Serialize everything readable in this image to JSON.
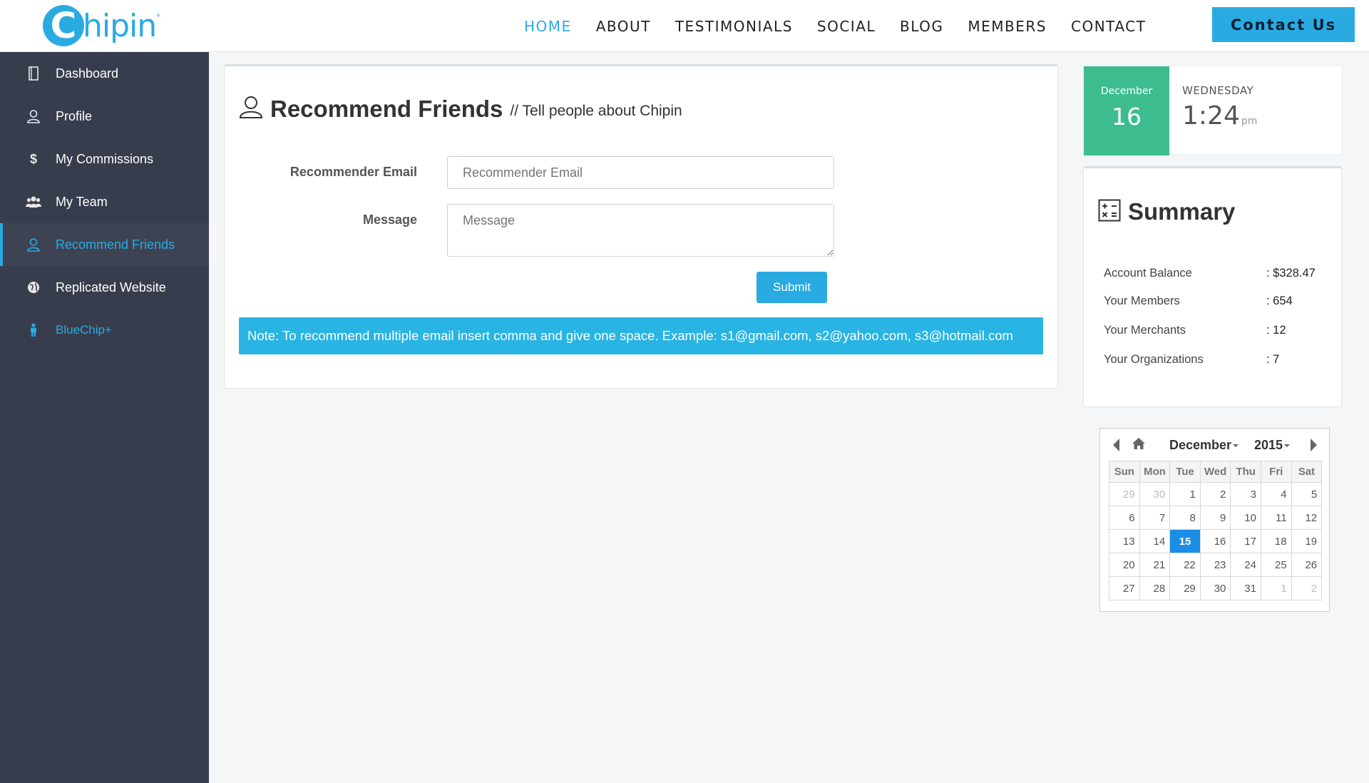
{
  "brand": {
    "logo_letter": "C",
    "logo_rest": "hipin",
    "logo_mark": "°"
  },
  "nav": {
    "items": [
      "HOME",
      "ABOUT",
      "TESTIMONIALS",
      "SOCIAL",
      "BLOG",
      "MEMBERS",
      "CONTACT"
    ],
    "active": "HOME",
    "cta": "Contact Us"
  },
  "sidebar": {
    "items": [
      {
        "label": "Dashboard",
        "icon": "notebook-icon"
      },
      {
        "label": "Profile",
        "icon": "user-icon"
      },
      {
        "label": "My Commissions",
        "icon": "dollar-icon"
      },
      {
        "label": "My Team",
        "icon": "group-icon"
      },
      {
        "label": "Recommend Friends",
        "icon": "user-icon"
      },
      {
        "label": "Replicated Website",
        "icon": "globe-icon"
      },
      {
        "label": "BlueChip+",
        "icon": "person-icon"
      }
    ],
    "active": "Recommend Friends"
  },
  "main": {
    "title": "Recommend Friends",
    "subtitle": "// Tell people about Chipin",
    "email_label": "Recommender Email",
    "email_placeholder": "Recommender Email",
    "message_label": "Message",
    "message_placeholder": "Message",
    "submit_label": "Submit",
    "note": "Note: To recommend multiple email insert comma and give one space. Example: s1@gmail.com, s2@yahoo.com, s3@hotmail.com"
  },
  "datetime": {
    "month": "December",
    "day": "16",
    "weekday": "WEDNESDAY",
    "time": "1:24",
    "ampm": "pm"
  },
  "summary": {
    "title": "Summary",
    "rows": [
      {
        "label": "Account Balance",
        "value": ": $328.47"
      },
      {
        "label": "Your Members",
        "value": ": 654"
      },
      {
        "label": "Your Merchants",
        "value": ": 12"
      },
      {
        "label": "Your Organizations",
        "value": ": 7"
      }
    ]
  },
  "calendar": {
    "month": "December",
    "year": "2015",
    "weekdays": [
      "Sun",
      "Mon",
      "Tue",
      "Wed",
      "Thu",
      "Fri",
      "Sat"
    ],
    "weeks": [
      [
        "29",
        "30",
        "1",
        "2",
        "3",
        "4",
        "5"
      ],
      [
        "6",
        "7",
        "8",
        "9",
        "10",
        "11",
        "12"
      ],
      [
        "13",
        "14",
        "15",
        "16",
        "17",
        "18",
        "19"
      ],
      [
        "20",
        "21",
        "22",
        "23",
        "24",
        "25",
        "26"
      ],
      [
        "27",
        "28",
        "29",
        "30",
        "31",
        "1",
        "2"
      ]
    ],
    "selected": "15"
  },
  "colors": {
    "accent": "#29abe2",
    "sidebar_bg": "#383d4e",
    "date_green": "#3dbd8e",
    "today": "#1a8ee6"
  }
}
